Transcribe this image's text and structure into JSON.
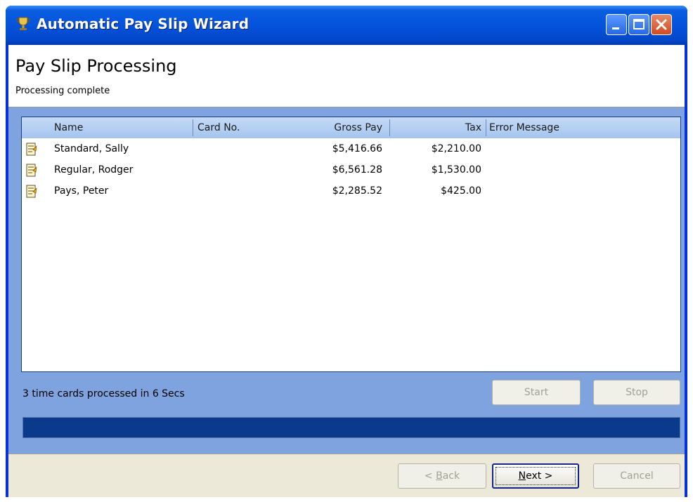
{
  "window": {
    "title": "Automatic Pay Slip Wizard",
    "icon": "trophy-icon",
    "controls": [
      "minimize-icon",
      "maximize-icon",
      "close-icon"
    ]
  },
  "header": {
    "title": "Pay Slip Processing",
    "subtitle": "Processing complete"
  },
  "list": {
    "columns": [
      "Name",
      "Card No.",
      "Gross Pay",
      "Tax",
      "Error Message"
    ],
    "rows": [
      {
        "icon": "timecard-icon",
        "name": "Standard, Sally",
        "card_no": "",
        "gross_pay": "$5,416.66",
        "tax": "$2,210.00",
        "error": ""
      },
      {
        "icon": "timecard-icon",
        "name": "Regular, Rodger",
        "card_no": "",
        "gross_pay": "$6,561.28",
        "tax": "$1,530.00",
        "error": ""
      },
      {
        "icon": "timecard-icon",
        "name": "Pays, Peter",
        "card_no": "",
        "gross_pay": "$2,285.52",
        "tax": "$425.00",
        "error": ""
      }
    ]
  },
  "status": {
    "text": "3 time cards processed in 6 Secs",
    "progress_percent": 100
  },
  "buttons": {
    "start": "Start",
    "stop": "Stop",
    "back_prefix": "< ",
    "back_accel": "B",
    "back_rest": "ack",
    "next_accel": "N",
    "next_rest": "ext >",
    "cancel": "Cancel"
  },
  "colors": {
    "title_bar": "#0453dc",
    "panel": "#7ea3de",
    "progress_fill": "#0a3a8c",
    "dialog_bg": "#ece9d8"
  }
}
